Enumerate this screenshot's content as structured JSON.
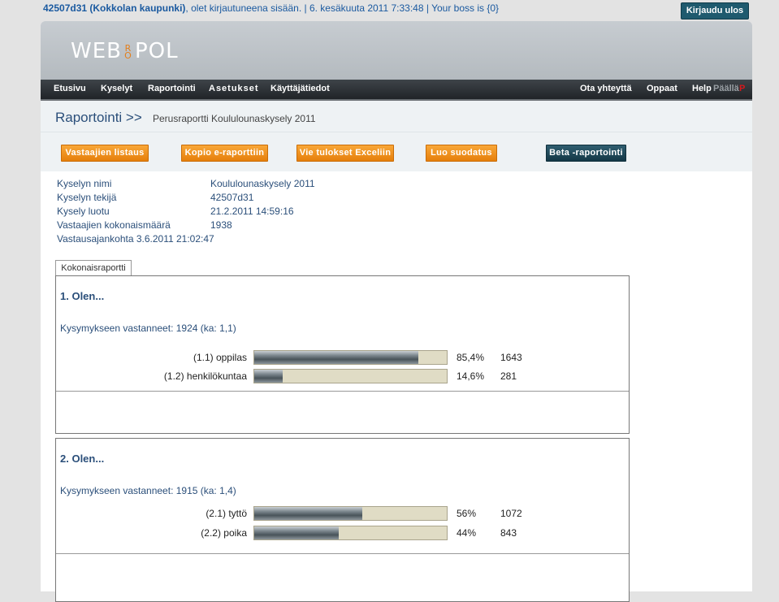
{
  "header": {
    "user_id": "42507d31",
    "org": "(Kokkolan kaupunki)",
    "login_text": ", olet kirjautuneena sisään. | 6. kesäkuuta 2011 7:33:48 | Your boss is {0}",
    "logout_label": "Kirjaudu ulos"
  },
  "brand": {
    "logo_left": "WEB",
    "logo_ro_top": "R",
    "logo_ro_bottom": "O",
    "logo_right": "POL"
  },
  "nav": {
    "items": [
      {
        "label": "Etusivu"
      },
      {
        "label": "Kyselyt"
      },
      {
        "label": "Raportointi"
      },
      {
        "label": "Asetukset"
      },
      {
        "label": "Käyttäjätiedot"
      }
    ],
    "right": [
      {
        "label": "Ota yhteyttä"
      },
      {
        "label": "Oppaat"
      },
      {
        "label": "Help"
      },
      {
        "label": "Päällä"
      },
      {
        "label": "P"
      }
    ]
  },
  "breadcrumb": {
    "title": "Raportointi >>",
    "subtitle": "Perusraportti Koululounaskysely 2011"
  },
  "actions": [
    {
      "label": "Vastaajien listaus"
    },
    {
      "label": "Kopio e-raporttiin"
    },
    {
      "label": "Vie tulokset Exceliin"
    },
    {
      "label": "Luo suodatus"
    },
    {
      "label": "Beta -raportointi"
    }
  ],
  "survey_info": [
    {
      "key": "Kyselyn nimi",
      "value": "Koululounaskysely 2011"
    },
    {
      "key": "Kyselyn tekijä",
      "value": "42507d31"
    },
    {
      "key": "Kysely luotu",
      "value": "21.2.2011 14:59:16"
    },
    {
      "key": "Vastaajien kokonaismäärä",
      "value": "1938"
    },
    {
      "key": "Vastausajankohta 3.6.2011 21:02:47",
      "value": ""
    }
  ],
  "tab": {
    "label": "Kokonaisraportti"
  },
  "questions": [
    {
      "title": "1. Olen...",
      "answered": "Kysymykseen vastanneet: 1924 (ka: 1,1)",
      "options": [
        {
          "label": "(1.1) oppilas",
          "percent": "85,4%",
          "count": "1643",
          "fraction": 0.854
        },
        {
          "label": "(1.2) henkilökuntaa",
          "percent": "14,6%",
          "count": "281",
          "fraction": 0.146
        }
      ]
    },
    {
      "title": "2. Olen...",
      "answered": "Kysymykseen vastanneet: 1915 (ka: 1,4)",
      "options": [
        {
          "label": "(2.1) tyttö",
          "percent": "56%",
          "count": "1072",
          "fraction": 0.56
        },
        {
          "label": "(2.2) poika",
          "percent": "44%",
          "count": "843",
          "fraction": 0.44
        }
      ]
    }
  ]
}
